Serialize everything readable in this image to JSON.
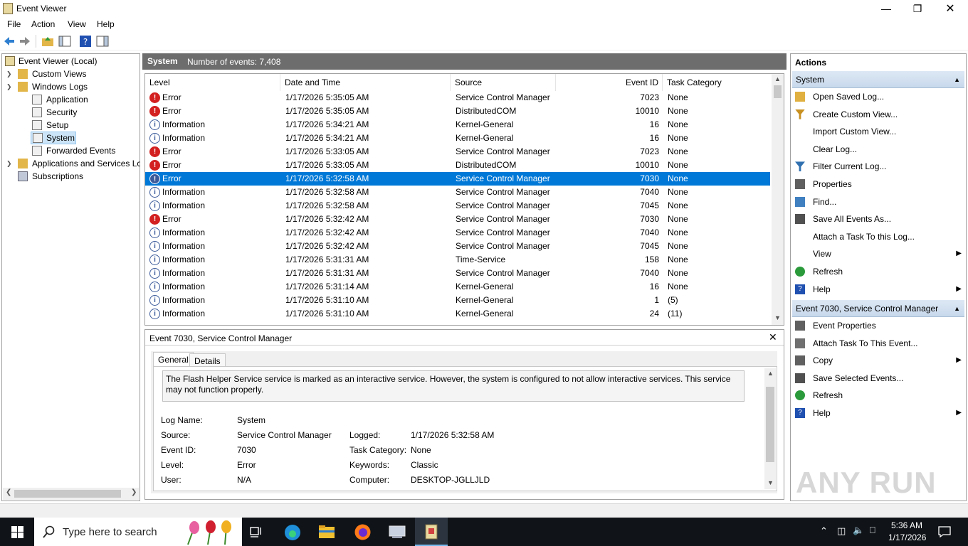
{
  "window": {
    "title": "Event Viewer"
  },
  "menu": [
    "File",
    "Action",
    "View",
    "Help"
  ],
  "tree": {
    "root": "Event Viewer (Local)",
    "custom_views": "Custom Views",
    "windows_logs": "Windows Logs",
    "logs": [
      "Application",
      "Security",
      "Setup",
      "System",
      "Forwarded Events"
    ],
    "app_services": "Applications and Services Lo",
    "subscriptions": "Subscriptions"
  },
  "center": {
    "log_name": "System",
    "count_text": "Number of events: 7,408"
  },
  "columns": [
    "Level",
    "Date and Time",
    "Source",
    "Event ID",
    "Task Category"
  ],
  "events": [
    {
      "level": "Error",
      "date": "1/17/2026 5:35:05 AM",
      "source": "Service Control Manager",
      "id": "7023",
      "task": "None"
    },
    {
      "level": "Error",
      "date": "1/17/2026 5:35:05 AM",
      "source": "DistributedCOM",
      "id": "10010",
      "task": "None"
    },
    {
      "level": "Information",
      "date": "1/17/2026 5:34:21 AM",
      "source": "Kernel-General",
      "id": "16",
      "task": "None"
    },
    {
      "level": "Information",
      "date": "1/17/2026 5:34:21 AM",
      "source": "Kernel-General",
      "id": "16",
      "task": "None"
    },
    {
      "level": "Error",
      "date": "1/17/2026 5:33:05 AM",
      "source": "Service Control Manager",
      "id": "7023",
      "task": "None"
    },
    {
      "level": "Error",
      "date": "1/17/2026 5:33:05 AM",
      "source": "DistributedCOM",
      "id": "10010",
      "task": "None"
    },
    {
      "level": "Error",
      "date": "1/17/2026 5:32:58 AM",
      "source": "Service Control Manager",
      "id": "7030",
      "task": "None",
      "selected": true
    },
    {
      "level": "Information",
      "date": "1/17/2026 5:32:58 AM",
      "source": "Service Control Manager",
      "id": "7040",
      "task": "None"
    },
    {
      "level": "Information",
      "date": "1/17/2026 5:32:58 AM",
      "source": "Service Control Manager",
      "id": "7045",
      "task": "None"
    },
    {
      "level": "Error",
      "date": "1/17/2026 5:32:42 AM",
      "source": "Service Control Manager",
      "id": "7030",
      "task": "None"
    },
    {
      "level": "Information",
      "date": "1/17/2026 5:32:42 AM",
      "source": "Service Control Manager",
      "id": "7040",
      "task": "None"
    },
    {
      "level": "Information",
      "date": "1/17/2026 5:32:42 AM",
      "source": "Service Control Manager",
      "id": "7045",
      "task": "None"
    },
    {
      "level": "Information",
      "date": "1/17/2026 5:31:31 AM",
      "source": "Time-Service",
      "id": "158",
      "task": "None"
    },
    {
      "level": "Information",
      "date": "1/17/2026 5:31:31 AM",
      "source": "Service Control Manager",
      "id": "7040",
      "task": "None"
    },
    {
      "level": "Information",
      "date": "1/17/2026 5:31:14 AM",
      "source": "Kernel-General",
      "id": "16",
      "task": "None"
    },
    {
      "level": "Information",
      "date": "1/17/2026 5:31:10 AM",
      "source": "Kernel-General",
      "id": "1",
      "task": "(5)"
    },
    {
      "level": "Information",
      "date": "1/17/2026 5:31:10 AM",
      "source": "Kernel-General",
      "id": "24",
      "task": "(11)"
    }
  ],
  "detail": {
    "title": "Event 7030, Service Control Manager",
    "tabs": [
      "General",
      "Details"
    ],
    "message": "The Flash Helper Service service is marked as an interactive service.  However, the system is configured to not allow interactive services.  This service may not function properly.",
    "log_name_label": "Log Name:",
    "log_name": "System",
    "source_label": "Source:",
    "source": "Service Control Manager",
    "logged_label": "Logged:",
    "logged": "1/17/2026 5:32:58 AM",
    "event_id_label": "Event ID:",
    "event_id": "7030",
    "task_label": "Task Category:",
    "task": "None",
    "level_label": "Level:",
    "level": "Error",
    "keywords_label": "Keywords:",
    "keywords": "Classic",
    "user_label": "User:",
    "user": "N/A",
    "computer_label": "Computer:",
    "computer": "DESKTOP-JGLLJLD"
  },
  "actions": {
    "header": "Actions",
    "group1": "System",
    "items1": [
      {
        "label": "Open Saved Log...",
        "icon": "folder-icon",
        "color": "#e0b040"
      },
      {
        "label": "Create Custom View...",
        "icon": "filter-icon",
        "color": "#c89020"
      },
      {
        "label": "Import Custom View...",
        "icon": "",
        "color": ""
      },
      {
        "label": "Clear Log...",
        "icon": "",
        "color": ""
      },
      {
        "label": "Filter Current Log...",
        "icon": "filter-icon",
        "color": "#3070b0"
      },
      {
        "label": "Properties",
        "icon": "properties-icon",
        "color": "#606060"
      },
      {
        "label": "Find...",
        "icon": "find-icon",
        "color": "#4080c0"
      },
      {
        "label": "Save All Events As...",
        "icon": "save-icon",
        "color": "#505050"
      },
      {
        "label": "Attach a Task To this Log...",
        "icon": "",
        "color": ""
      },
      {
        "label": "View",
        "icon": "",
        "color": "",
        "submenu": true
      },
      {
        "label": "Refresh",
        "icon": "refresh-icon",
        "color": "#2a9a3a"
      },
      {
        "label": "Help",
        "icon": "help-icon",
        "color": "#2050b0",
        "submenu": true
      }
    ],
    "group2": "Event 7030, Service Control Manager",
    "items2": [
      {
        "label": "Event Properties",
        "icon": "properties-icon",
        "color": "#606060"
      },
      {
        "label": "Attach Task To This Event...",
        "icon": "task-icon",
        "color": "#707070"
      },
      {
        "label": "Copy",
        "icon": "copy-icon",
        "color": "#606060",
        "submenu": true
      },
      {
        "label": "Save Selected Events...",
        "icon": "save-icon",
        "color": "#505050"
      },
      {
        "label": "Refresh",
        "icon": "refresh-icon",
        "color": "#2a9a3a"
      },
      {
        "label": "Help",
        "icon": "help-icon",
        "color": "#2050b0",
        "submenu": true
      }
    ]
  },
  "taskbar": {
    "search_placeholder": "Type here to search",
    "time": "5:36 AM",
    "date": "1/17/2026"
  },
  "watermark": "ANY RUN",
  "colors": {
    "selection": "#0078d7",
    "header_bar": "#6d6d6d",
    "error": "#d32020",
    "taskbar": "#101418"
  }
}
